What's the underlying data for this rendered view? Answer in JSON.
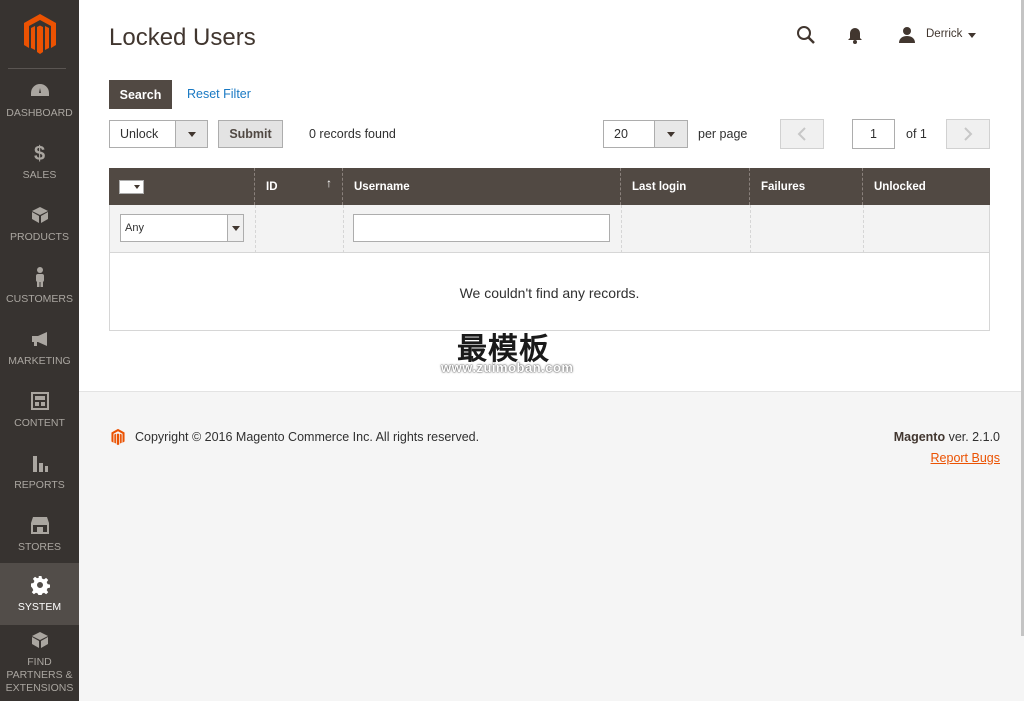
{
  "sidebar": {
    "items": [
      {
        "label": "DASHBOARD",
        "icon": "dashboard-icon"
      },
      {
        "label": "SALES",
        "icon": "dollar-icon"
      },
      {
        "label": "PRODUCTS",
        "icon": "cube-icon"
      },
      {
        "label": "CUSTOMERS",
        "icon": "person-icon"
      },
      {
        "label": "MARKETING",
        "icon": "megaphone-icon"
      },
      {
        "label": "CONTENT",
        "icon": "content-icon"
      },
      {
        "label": "REPORTS",
        "icon": "bar-chart-icon"
      },
      {
        "label": "STORES",
        "icon": "store-icon"
      },
      {
        "label": "SYSTEM",
        "icon": "gear-icon",
        "active": true
      },
      {
        "label": "FIND PARTNERS & EXTENSIONS",
        "icon": "box-icon"
      }
    ]
  },
  "header": {
    "title": "Locked Users",
    "user": "Derrick"
  },
  "actions": {
    "search_label": "Search",
    "reset_label": "Reset Filter",
    "mass_action": "Unlock",
    "submit_label": "Submit",
    "records_found": "0 records found",
    "page_size": "20",
    "per_page_label": "per page",
    "current_page": "1",
    "page_total": "of 1"
  },
  "grid": {
    "columns": [
      "ID",
      "Username",
      "Last login",
      "Failures",
      "Unlocked"
    ],
    "filter_any": "Any",
    "empty_message": "We couldn't find any records."
  },
  "watermark": {
    "cn": "最模板",
    "url": "www.zuimoban.com"
  },
  "footer": {
    "copyright": "Copyright © 2016 Magento Commerce Inc. All rights reserved.",
    "brand": "Magento",
    "version": " ver. 2.1.0",
    "report_bugs": "Report Bugs"
  },
  "colors": {
    "sidebar_bg": "#373330",
    "header_bg": "#514943",
    "accent_orange": "#eb5202",
    "link_blue": "#1979c3"
  }
}
